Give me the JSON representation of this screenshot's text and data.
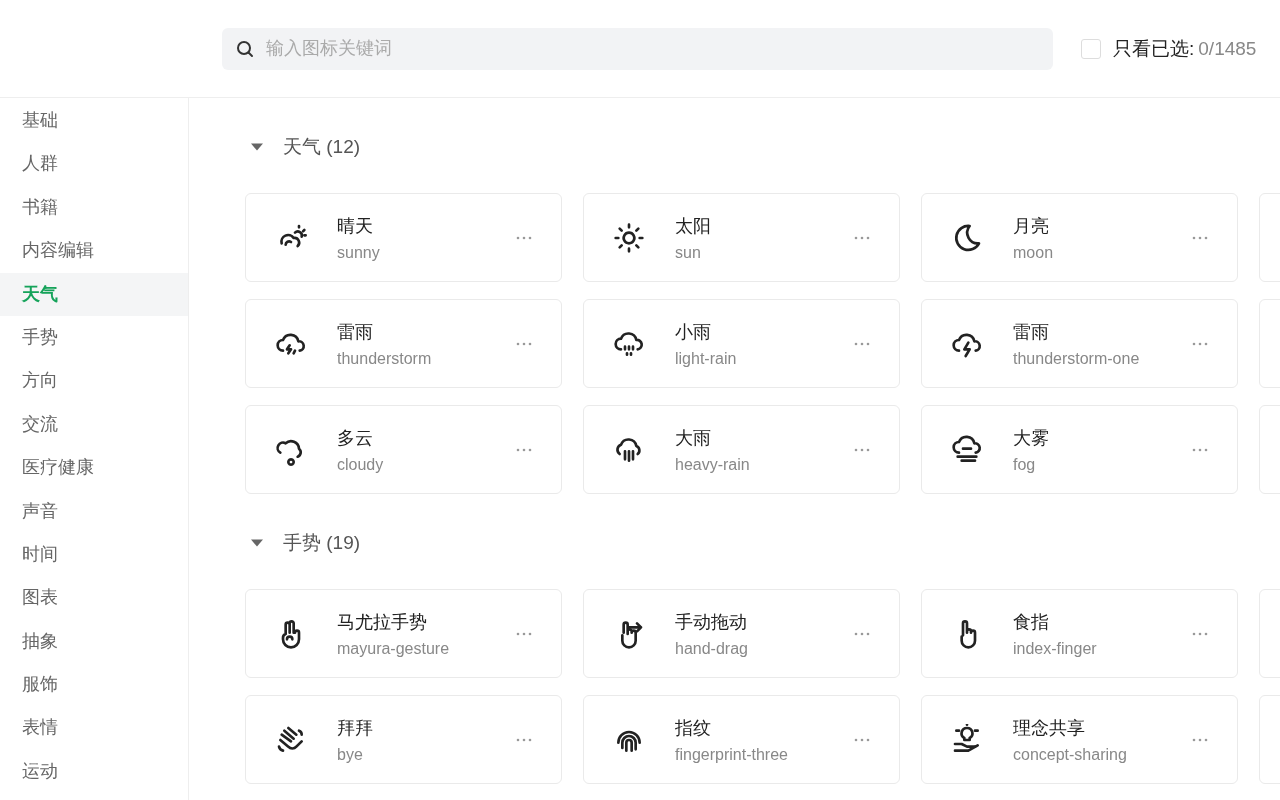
{
  "search": {
    "placeholder": "输入图标关键词"
  },
  "filter": {
    "checked": false,
    "label": "只看已选:",
    "count": "0/1485"
  },
  "sidebar": {
    "items": [
      {
        "label": "基础",
        "selected": false
      },
      {
        "label": "人群",
        "selected": false
      },
      {
        "label": "书籍",
        "selected": false
      },
      {
        "label": "内容编辑",
        "selected": false
      },
      {
        "label": "天气",
        "selected": true
      },
      {
        "label": "手势",
        "selected": false
      },
      {
        "label": "方向",
        "selected": false
      },
      {
        "label": "交流",
        "selected": false
      },
      {
        "label": "医疗健康",
        "selected": false
      },
      {
        "label": "声音",
        "selected": false
      },
      {
        "label": "时间",
        "selected": false
      },
      {
        "label": "图表",
        "selected": false
      },
      {
        "label": "抽象",
        "selected": false
      },
      {
        "label": "服饰",
        "selected": false
      },
      {
        "label": "表情",
        "selected": false
      },
      {
        "label": "运动",
        "selected": false
      }
    ]
  },
  "sections": [
    {
      "title": "天气 (12)",
      "expanded": true,
      "cards": [
        {
          "title": "晴天",
          "name": "sunny"
        },
        {
          "title": "太阳",
          "name": "sun"
        },
        {
          "title": "月亮",
          "name": "moon"
        },
        {
          "title": "雷雨",
          "name": "thunderstorm"
        },
        {
          "title": "小雨",
          "name": "light-rain"
        },
        {
          "title": "雷雨",
          "name": "thunderstorm-one"
        },
        {
          "title": "多云",
          "name": "cloudy"
        },
        {
          "title": "大雨",
          "name": "heavy-rain"
        },
        {
          "title": "大雾",
          "name": "fog"
        }
      ]
    },
    {
      "title": "手势 (19)",
      "expanded": true,
      "cards": [
        {
          "title": "马尤拉手势",
          "name": "mayura-gesture"
        },
        {
          "title": "手动拖动",
          "name": "hand-drag"
        },
        {
          "title": "食指",
          "name": "index-finger"
        },
        {
          "title": "拜拜",
          "name": "bye"
        },
        {
          "title": "指纹",
          "name": "fingerprint-three"
        },
        {
          "title": "理念共享",
          "name": "concept-sharing"
        }
      ]
    }
  ]
}
